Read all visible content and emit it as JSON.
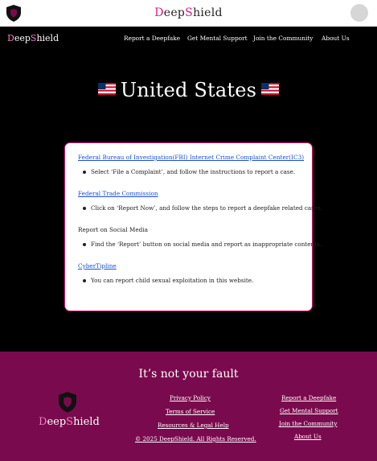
{
  "header": {
    "brand_first": "D",
    "brand_mid": "eep",
    "brand_s": "S",
    "brand_rest": "hield"
  },
  "nav": {
    "brand_first": "D",
    "brand_mid": "eep",
    "brand_s": "S",
    "brand_rest": "hield",
    "links": [
      "Report a Deepfake",
      "Get Mental Support",
      "Join the Community",
      "About Us"
    ]
  },
  "page": {
    "title": "United States"
  },
  "resources": [
    {
      "title": "Federal Bureau of Investigation(FBI) Internet Crime Complaint Center(IC3)",
      "is_link": true,
      "instruction": "Select ‘File a Complaint’, and follow the instructions to report a case."
    },
    {
      "title": "Federal Trade Commission",
      "is_link": true,
      "instruction": "Click on ‘Report Now’, and follow the steps to report a deepfake related cases."
    },
    {
      "title": "Report on Social Media",
      "is_link": false,
      "instruction": "Find the ‘Report’ button on social media and report as inappropriate contents."
    },
    {
      "title": "CyberTipline",
      "is_link": true,
      "instruction": "You can report child sexual exploitation in this website."
    }
  ],
  "footer": {
    "tagline": "It’s not your fault",
    "brand_first": "D",
    "brand_mid": "eep",
    "brand_s": "S",
    "brand_rest": "hield",
    "legal_links": [
      "Privacy Policy",
      "Terms of Service",
      "Resources & Legal Help"
    ],
    "copyright": "© 2025 DeepShield. All Rights Reserved.",
    "nav_links": [
      "Report a Deepfake",
      "Get Mental Support",
      "Join the Community",
      "About Us"
    ]
  },
  "colors": {
    "accent": "#e0177d",
    "footer_bg": "#7a0a4e",
    "link": "#1a4fd6"
  }
}
